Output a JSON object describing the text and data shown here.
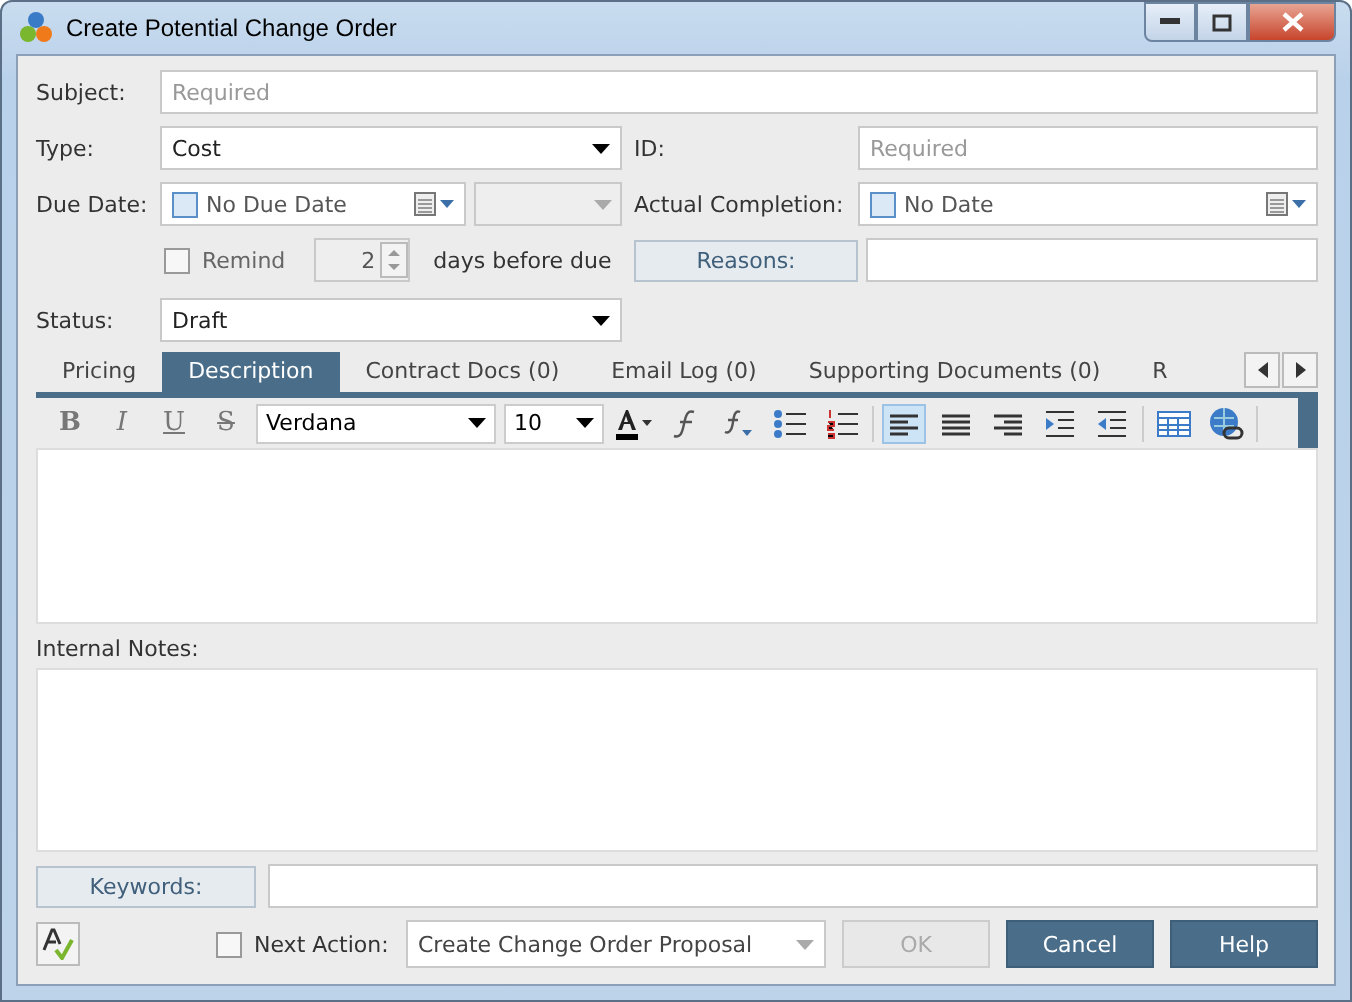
{
  "window": {
    "title": "Create Potential Change Order"
  },
  "subject": {
    "label": "Subject:",
    "placeholder": "Required"
  },
  "type": {
    "label": "Type:",
    "value": "Cost"
  },
  "id": {
    "label": "ID:",
    "placeholder": "Required"
  },
  "due_date": {
    "label": "Due Date:",
    "checked": false,
    "value": "No Due Date"
  },
  "remind": {
    "label": "Remind",
    "checked": false,
    "value": "2",
    "suffix": "days before due"
  },
  "actual_completion": {
    "label": "Actual Completion:",
    "checked": false,
    "value": "No Date"
  },
  "reasons": {
    "label": "Reasons:"
  },
  "status": {
    "label": "Status:",
    "value": "Draft"
  },
  "tabs": [
    {
      "label": "Pricing",
      "selected": false
    },
    {
      "label": "Description",
      "selected": true
    },
    {
      "label": "Contract Docs (0)",
      "selected": false
    },
    {
      "label": "Email Log (0)",
      "selected": false
    },
    {
      "label": "Supporting Documents (0)",
      "selected": false
    },
    {
      "label": "R",
      "selected": false
    }
  ],
  "toolbar": {
    "styles": [
      "B",
      "I",
      "U",
      "S"
    ],
    "font": "Verdana",
    "size": "10",
    "align": [
      {
        "selected": true
      },
      {
        "selected": false
      },
      {
        "selected": false
      }
    ]
  },
  "internal_notes": {
    "label": "Internal Notes:"
  },
  "keywords": {
    "label": "Keywords:"
  },
  "next_action": {
    "label": "Next Action:",
    "checked": false,
    "value": "Create Change Order Proposal"
  },
  "buttons": [
    {
      "label": "OK",
      "disabled": true
    },
    {
      "label": "Cancel",
      "disabled": false
    },
    {
      "label": "Help",
      "disabled": false
    }
  ]
}
